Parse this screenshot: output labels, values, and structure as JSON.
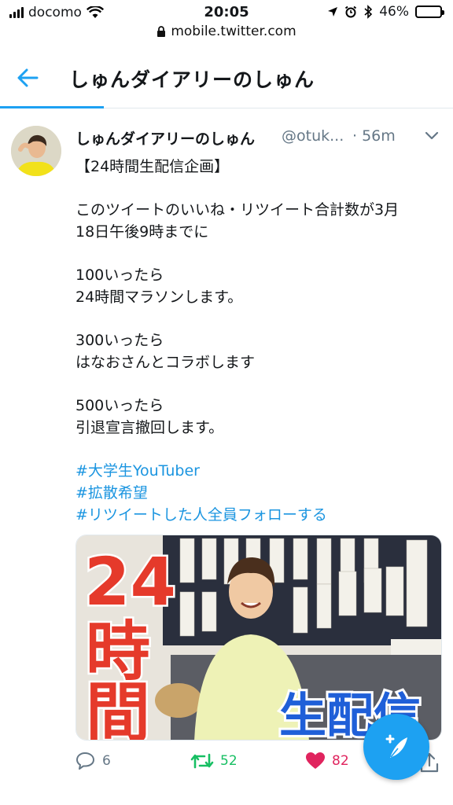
{
  "status_bar": {
    "carrier": "docomo",
    "time": "20:05",
    "battery": "46%",
    "battery_level": 0.46
  },
  "browser": {
    "url": "mobile.twitter.com"
  },
  "header": {
    "title": "しゅんダイアリーのしゅん"
  },
  "tweet": {
    "author_name": "しゅんダイアリーのしゅん",
    "handle": "@otuk...",
    "time": "· 56m",
    "lines": {
      "l1": "【24時間生配信企画】",
      "l2": "このツイートのいいね・リツイート合計数が3月",
      "l3": "18日午後9時までに",
      "l4": "100いったら",
      "l5": "24時間マラソンします。",
      "l6": "300いったら",
      "l7": "はなおさんとコラボします",
      "l8": "500いったら",
      "l9": "引退宣言撤回します。"
    },
    "hashtags": [
      "#大学生YouTuber",
      "#拡散希望",
      "#リツイートした人全員フォローする"
    ],
    "media": {
      "text_24": "24",
      "text_ji": "時",
      "text_kan": "間",
      "text_live": "生配信"
    },
    "actions": {
      "replies": "6",
      "retweets": "52",
      "likes": "82"
    }
  },
  "colors": {
    "accent": "#1da1f2",
    "retweet": "#17bf63",
    "like": "#e0245e",
    "muted": "#657786"
  }
}
